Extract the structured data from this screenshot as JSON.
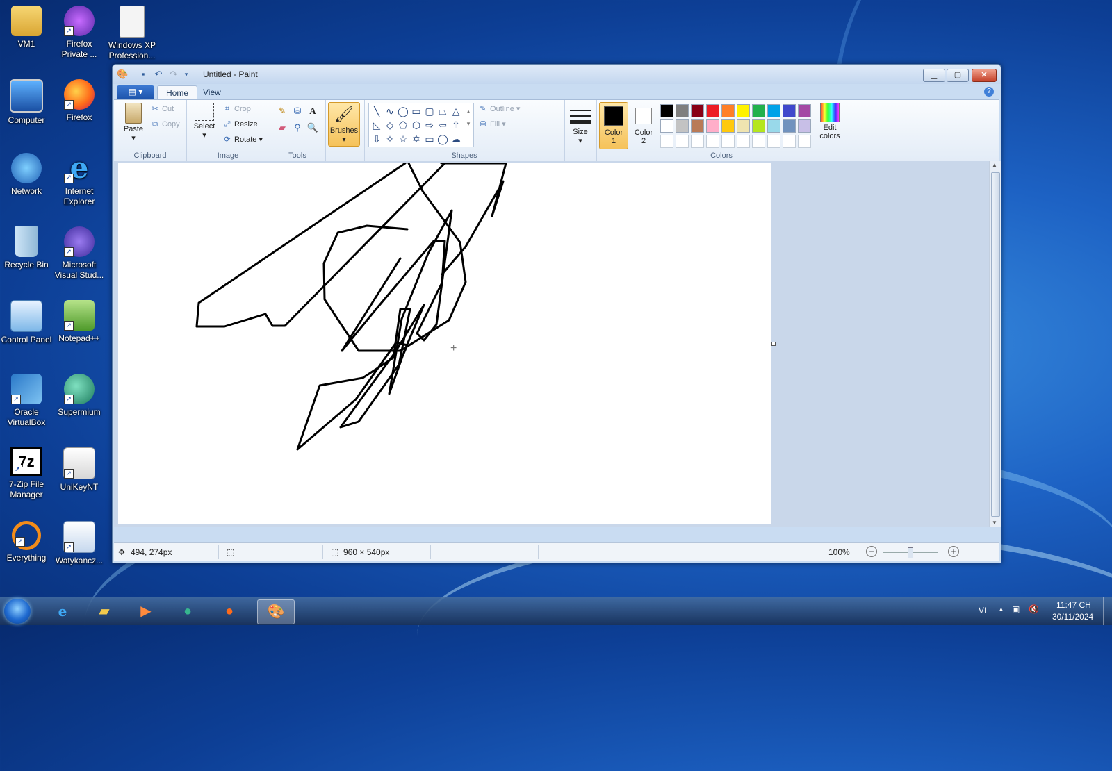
{
  "desktop": {
    "icons": [
      {
        "label": "VM1"
      },
      {
        "label": "Firefox Private ..."
      },
      {
        "label": "Windows XP Profession..."
      },
      {
        "label": "Computer"
      },
      {
        "label": "Firefox"
      },
      {
        "label": "Network"
      },
      {
        "label": "Internet Explorer"
      },
      {
        "label": "Recycle Bin"
      },
      {
        "label": "Microsoft Visual Stud..."
      },
      {
        "label": "Control Panel"
      },
      {
        "label": "Notepad++"
      },
      {
        "label": "Oracle VirtualBox"
      },
      {
        "label": "Supermium"
      },
      {
        "label": "7-Zip File Manager"
      },
      {
        "label": "UniKeyNT"
      },
      {
        "label": "Everything"
      },
      {
        "label": "Watykancz..."
      }
    ]
  },
  "window": {
    "title": "Untitled - Paint",
    "tabs": [
      "Home",
      "View"
    ],
    "groups": {
      "clipboard": "Clipboard",
      "image": "Image",
      "tools": "Tools",
      "shapes": "Shapes",
      "colors": "Colors"
    },
    "clipboard": {
      "paste": "Paste",
      "cut": "Cut",
      "copy": "Copy"
    },
    "image": {
      "select": "Select",
      "crop": "Crop",
      "resize": "Resize",
      "rotate": "Rotate"
    },
    "brushes": "Brushes",
    "shapes_opts": {
      "outline": "Outline",
      "fill": "Fill"
    },
    "size": "Size",
    "color1": "Color 1",
    "color2": "Color 2",
    "edit_colors": "Edit colors",
    "palette_row1": [
      "#000000",
      "#7f7f7f",
      "#880015",
      "#ed1c24",
      "#ff7f27",
      "#fff200",
      "#22b14c",
      "#00a2e8",
      "#3f48cc",
      "#a349a4"
    ],
    "palette_row2": [
      "#ffffff",
      "#c3c3c3",
      "#b97a57",
      "#ffaec9",
      "#ffc90e",
      "#efe4b0",
      "#b5e61d",
      "#99d9ea",
      "#7092be",
      "#c8bfe7"
    ],
    "color1_value": "#000000",
    "color2_value": "#ffffff"
  },
  "status": {
    "cursor_pos": "494, 274px",
    "canvas_size": "960 × 540px",
    "zoom": "100%"
  },
  "taskbar": {
    "lang": "VI",
    "time": "11:47 CH",
    "date": "30/11/2024"
  }
}
